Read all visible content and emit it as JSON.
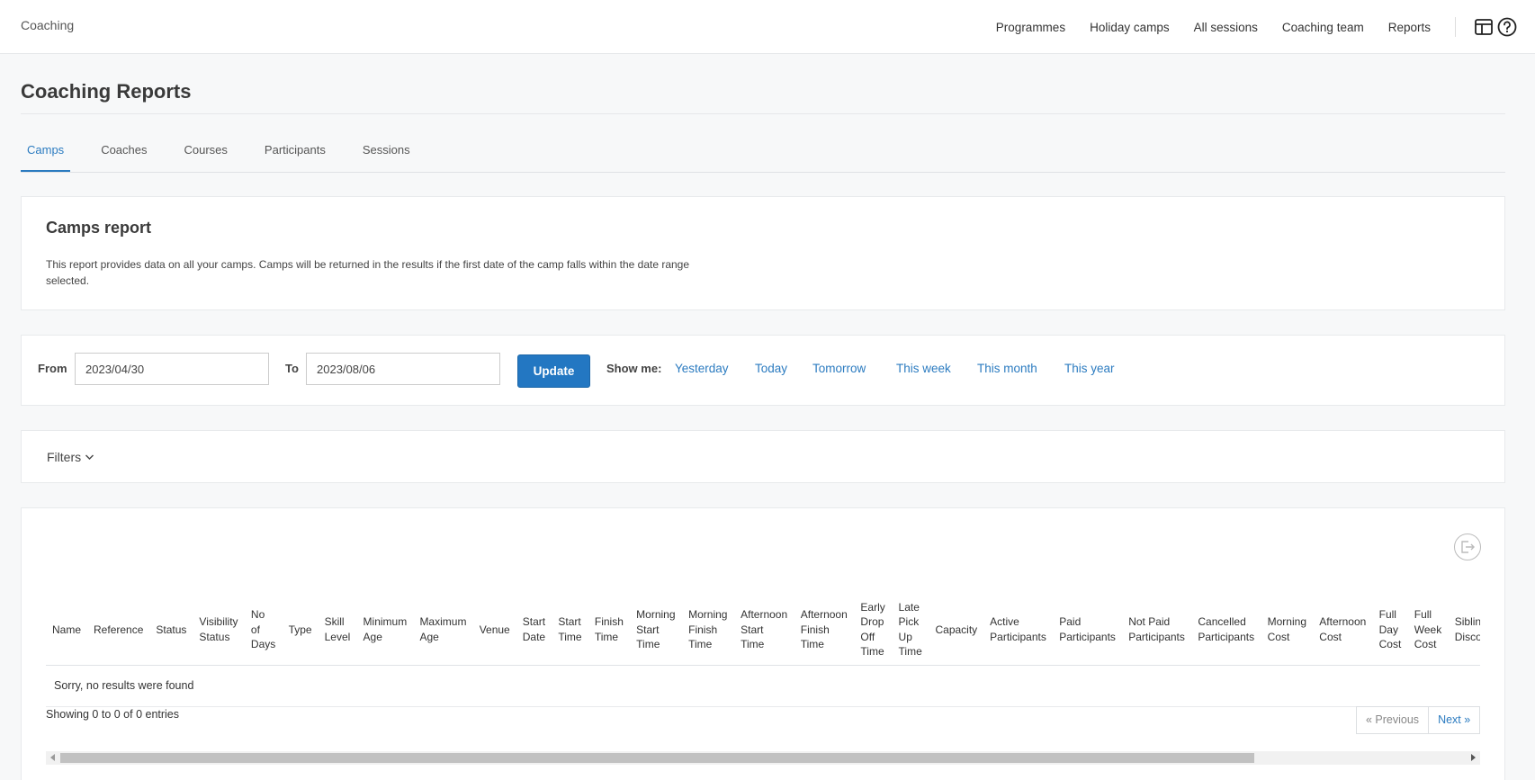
{
  "header": {
    "brand": "Coaching",
    "nav": [
      "Programmes",
      "Holiday camps",
      "All sessions",
      "Coaching team",
      "Reports"
    ],
    "icons": [
      "window-icon",
      "help-icon"
    ]
  },
  "page": {
    "title": "Coaching Reports",
    "tabs": [
      {
        "label": "Camps",
        "active": true
      },
      {
        "label": "Coaches",
        "active": false
      },
      {
        "label": "Courses",
        "active": false
      },
      {
        "label": "Participants",
        "active": false
      },
      {
        "label": "Sessions",
        "active": false
      }
    ]
  },
  "report": {
    "title": "Camps report",
    "description": "This report provides data on all your camps. Camps will be returned in the results if the first date of the camp falls within the date range selected."
  },
  "date_range": {
    "from_label": "From",
    "from_value": "2023/04/30",
    "to_label": "To",
    "to_value": "2023/08/06",
    "update_label": "Update",
    "show_me_label": "Show me:",
    "quick_links": [
      "Yesterday",
      "Today",
      "Tomorrow",
      "This week",
      "This month",
      "This year"
    ]
  },
  "filters": {
    "label": "Filters"
  },
  "table": {
    "columns": [
      "Name",
      "Reference",
      "Status",
      "Visibility Status",
      "No of Days",
      "Type",
      "Skill Level",
      "Minimum Age",
      "Maximum Age",
      "Venue",
      "Start Date",
      "Start Time",
      "Finish Time",
      "Morning Start Time",
      "Morning Finish Time",
      "Afternoon Start Time",
      "Afternoon Finish Time",
      "Early Drop Off Time",
      "Late Pick Up Time",
      "Capacity",
      "Active Participants",
      "Paid Participants",
      "Not Paid Participants",
      "Cancelled Participants",
      "Morning Cost",
      "Afternoon Cost",
      "Full Day Cost",
      "Full Week Cost",
      "Sibling Discount"
    ],
    "empty_message": "Sorry, no results were found",
    "showing": "Showing 0 to 0 of 0 entries",
    "prev_label": "« Previous",
    "next_label": "Next »"
  },
  "colors": {
    "accent": "#2377c2",
    "link": "#2b7bc0"
  }
}
